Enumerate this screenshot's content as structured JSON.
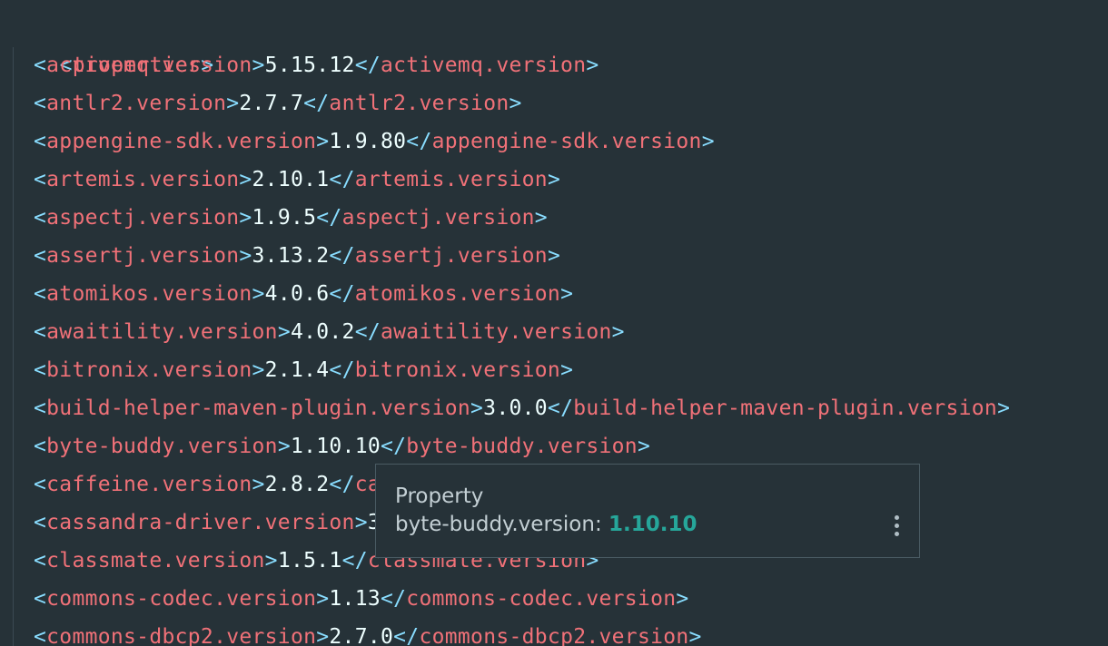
{
  "editor": {
    "root_tag": "properties",
    "lines": [
      {
        "tag": "activemq.version",
        "value": "5.15.12"
      },
      {
        "tag": "antlr2.version",
        "value": "2.7.7"
      },
      {
        "tag": "appengine-sdk.version",
        "value": "1.9.80"
      },
      {
        "tag": "artemis.version",
        "value": "2.10.1"
      },
      {
        "tag": "aspectj.version",
        "value": "1.9.5"
      },
      {
        "tag": "assertj.version",
        "value": "3.13.2"
      },
      {
        "tag": "atomikos.version",
        "value": "4.0.6"
      },
      {
        "tag": "awaitility.version",
        "value": "4.0.2"
      },
      {
        "tag": "bitronix.version",
        "value": "2.1.4"
      },
      {
        "tag": "build-helper-maven-plugin.version",
        "value": "3.0.0"
      },
      {
        "tag": "byte-buddy.version",
        "value": "1.10.10"
      },
      {
        "tag": "caffeine.version",
        "value": "2.8.2"
      },
      {
        "tag": "cassandra-driver.version",
        "value": "3"
      },
      {
        "tag": "classmate.version",
        "value": "1.5.1"
      },
      {
        "tag": "commons-codec.version",
        "value": "1.13"
      },
      {
        "tag": "commons-dbcp2.version",
        "value": "2.7.0"
      }
    ]
  },
  "popup": {
    "title": "Property",
    "property_name": "byte-buddy.version",
    "separator": ": ",
    "property_value": "1.10.10",
    "more_icon": "more-vertical-icon"
  },
  "colors": {
    "background": "#263238",
    "bracket": "#89ddff",
    "tag": "#f07178",
    "text": "#eeffff",
    "popup_value": "#26a69a"
  }
}
